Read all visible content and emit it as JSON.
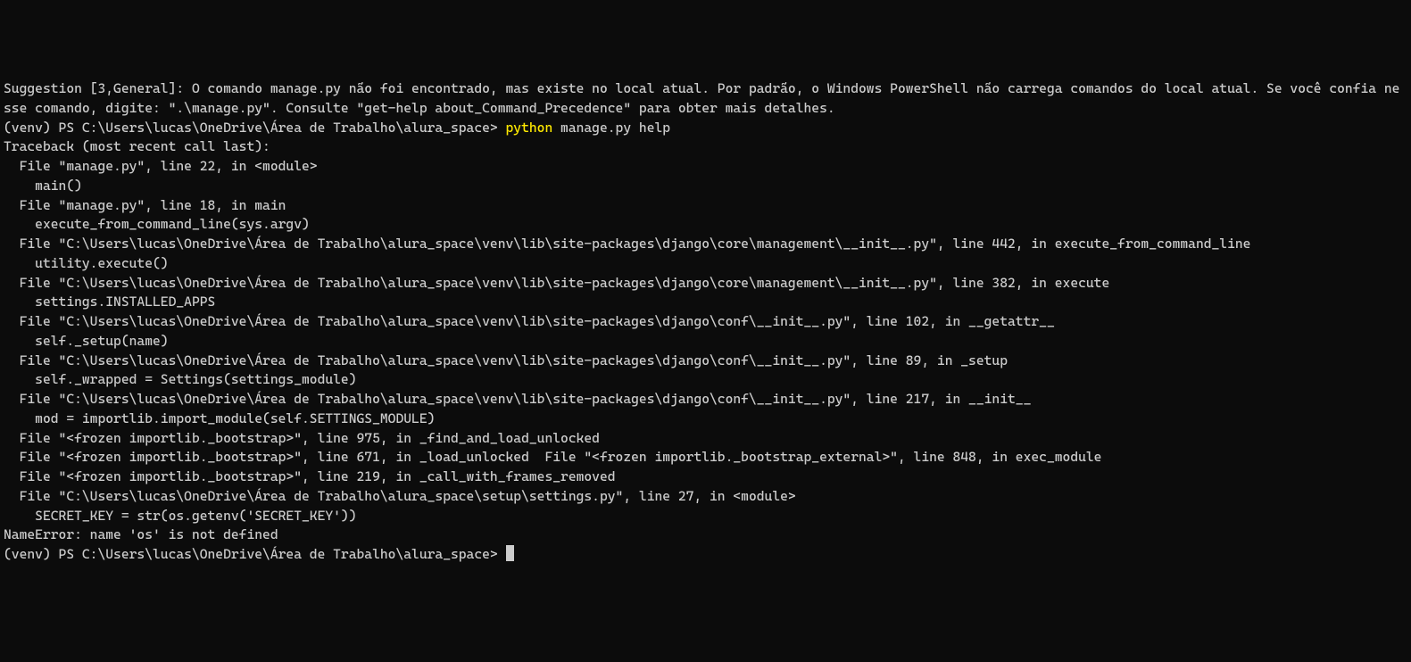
{
  "suggestion_line": "Suggestion [3,General]: O comando manage.py não foi encontrado, mas existe no local atual. Por padrão, o Windows PowerShell não carrega comandos do local atual. Se você confia nesse comando, digite: \".\\manage.py\". Consulte \"get-help about_Command_Precedence\" para obter mais detalhes.",
  "prompt1": {
    "prefix": "(venv) PS C:\\Users\\lucas\\OneDrive\\Área de Trabalho\\alura_space> ",
    "cmd_highlight": "python",
    "cmd_rest": " manage.py help"
  },
  "traceback": [
    "Traceback (most recent call last):",
    "  File \"manage.py\", line 22, in <module>",
    "    main()",
    "  File \"manage.py\", line 18, in main",
    "    execute_from_command_line(sys.argv)",
    "  File \"C:\\Users\\lucas\\OneDrive\\Área de Trabalho\\alura_space\\venv\\lib\\site-packages\\django\\core\\management\\__init__.py\", line 442, in execute_from_command_line",
    "    utility.execute()",
    "  File \"C:\\Users\\lucas\\OneDrive\\Área de Trabalho\\alura_space\\venv\\lib\\site-packages\\django\\core\\management\\__init__.py\", line 382, in execute",
    "    settings.INSTALLED_APPS",
    "  File \"C:\\Users\\lucas\\OneDrive\\Área de Trabalho\\alura_space\\venv\\lib\\site-packages\\django\\conf\\__init__.py\", line 102, in __getattr__",
    "    self._setup(name)",
    "  File \"C:\\Users\\lucas\\OneDrive\\Área de Trabalho\\alura_space\\venv\\lib\\site-packages\\django\\conf\\__init__.py\", line 89, in _setup",
    "    self._wrapped = Settings(settings_module)",
    "  File \"C:\\Users\\lucas\\OneDrive\\Área de Trabalho\\alura_space\\venv\\lib\\site-packages\\django\\conf\\__init__.py\", line 217, in __init__",
    "    mod = importlib.import_module(self.SETTINGS_MODULE)",
    "  File \"<frozen importlib._bootstrap>\", line 975, in _find_and_load_unlocked",
    "  File \"<frozen importlib._bootstrap>\", line 671, in _load_unlocked  File \"<frozen importlib._bootstrap_external>\", line 848, in exec_module",
    "  File \"<frozen importlib._bootstrap>\", line 219, in _call_with_frames_removed",
    "  File \"C:\\Users\\lucas\\OneDrive\\Área de Trabalho\\alura_space\\setup\\settings.py\", line 27, in <module>",
    "    SECRET_KEY = str(os.getenv('SECRET_KEY'))",
    "NameError: name 'os' is not defined"
  ],
  "prompt2": {
    "prefix": "(venv) PS C:\\Users\\lucas\\OneDrive\\Área de Trabalho\\alura_space> "
  }
}
